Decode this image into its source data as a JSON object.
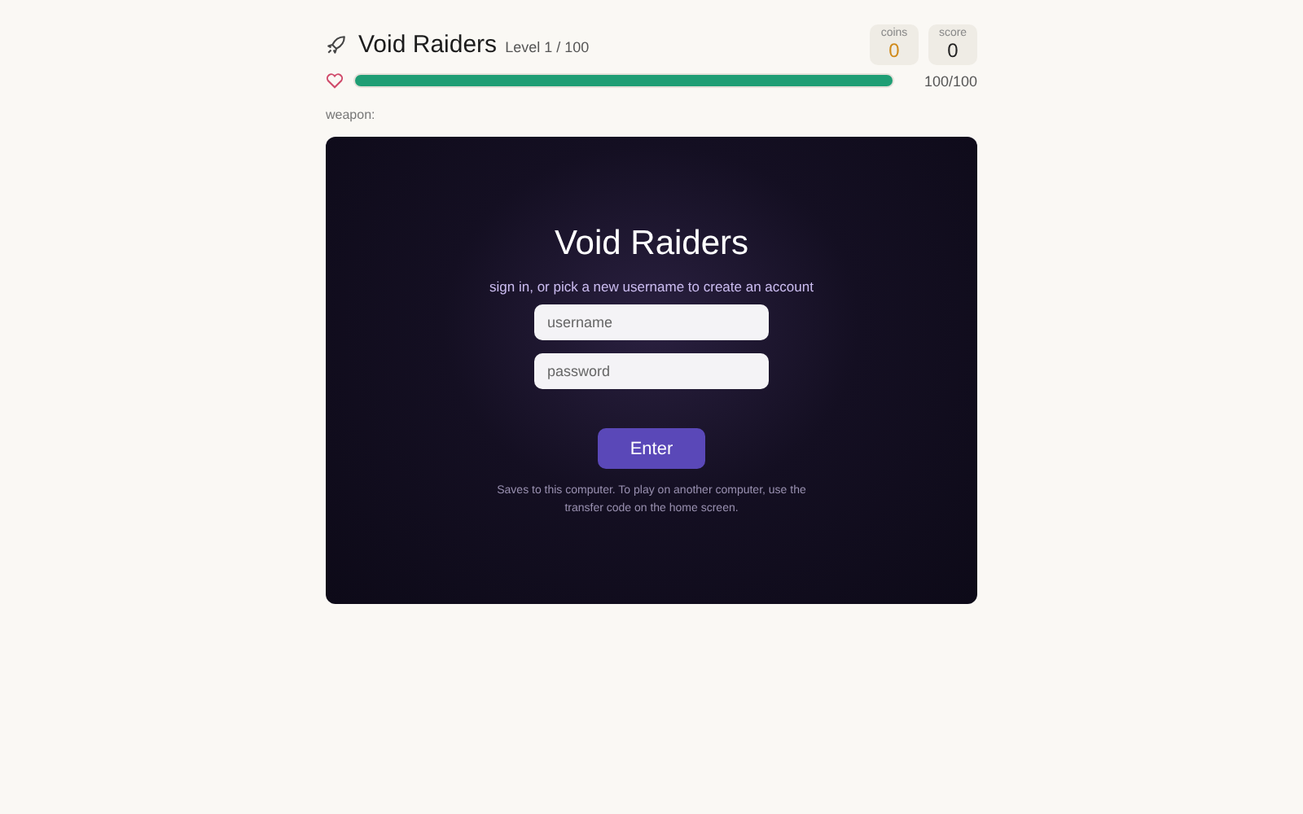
{
  "header": {
    "title": "Void Raiders",
    "level": "Level 1 / 100"
  },
  "stats": [
    {
      "label": "coins",
      "value": "0",
      "kind": "coins"
    },
    {
      "label": "score",
      "value": "0",
      "kind": "score"
    }
  ],
  "health": {
    "level": 1.0,
    "reading": "100/100"
  },
  "weapon": {
    "label": "weapon:"
  },
  "login": {
    "title": "Void Raiders",
    "subtitle": "sign in, or pick a new username to create an account",
    "fields": [
      {
        "placeholder": "username"
      },
      {
        "placeholder": "password"
      }
    ],
    "button": "Enter",
    "note": "Saves to this computer. To play on another computer, use the transfer code on the home screen."
  }
}
